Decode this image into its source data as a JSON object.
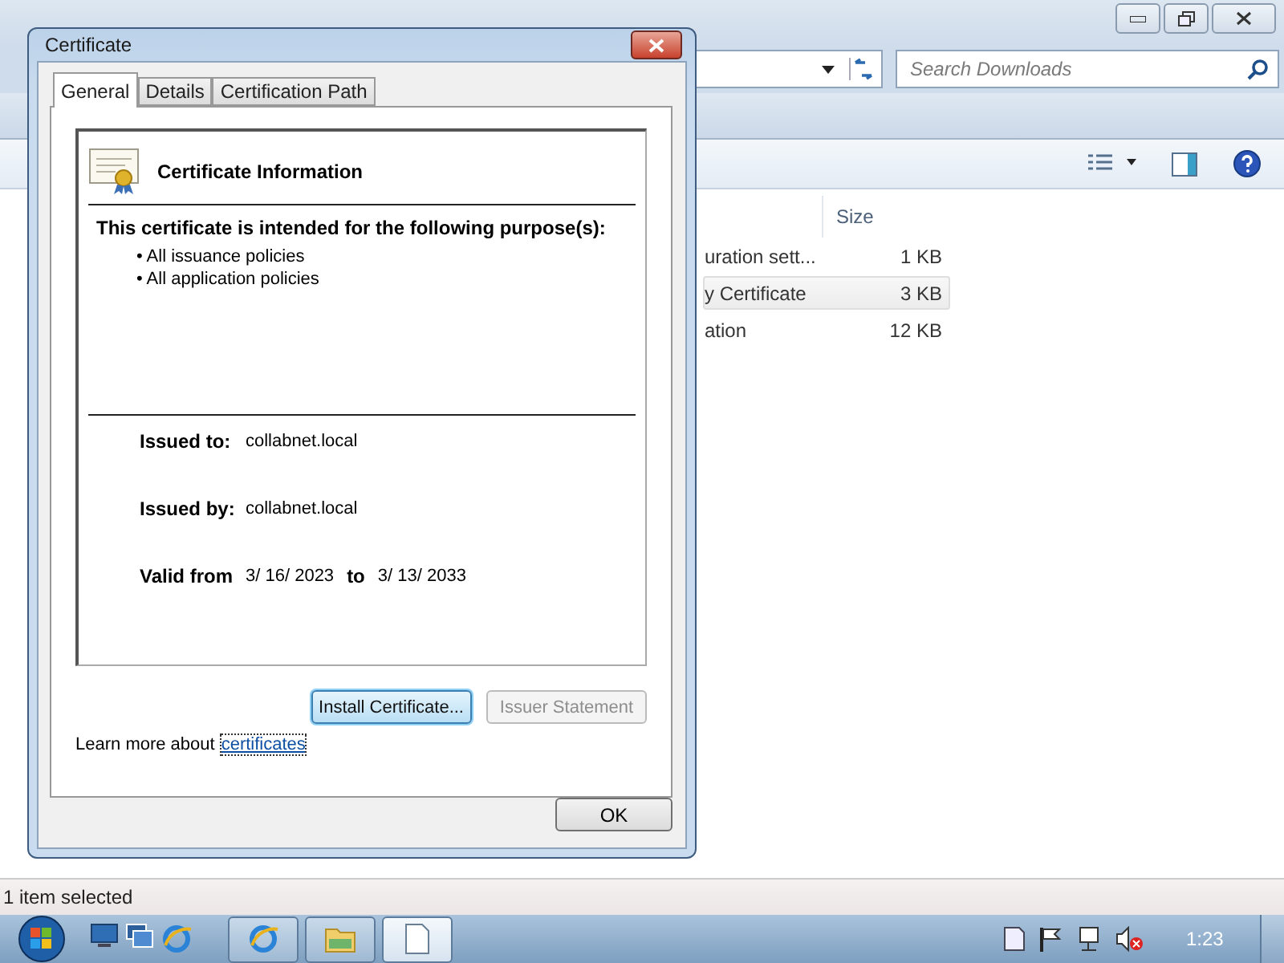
{
  "explorer": {
    "search": {
      "placeholder": "Search Downloads"
    },
    "columns": [
      "Size"
    ],
    "files": [
      {
        "name": "uration sett...",
        "size": "1 KB",
        "selected": false
      },
      {
        "name": "y Certificate",
        "size": "3 KB",
        "selected": true
      },
      {
        "name": "ation",
        "size": "12 KB",
        "selected": false
      }
    ],
    "status_bar": "1 item selected"
  },
  "dialog": {
    "title": "Certificate",
    "tabs": [
      {
        "label": "General",
        "selected": true
      },
      {
        "label": "Details",
        "selected": false
      },
      {
        "label": "Certification Path",
        "selected": false
      }
    ],
    "heading": "Certificate Information",
    "purpose_title": "This certificate is intended for the following purpose(s):",
    "purposes": [
      "• All issuance policies",
      "• All application policies"
    ],
    "fields": [
      {
        "label": "Issued to:",
        "value": "collabnet.local"
      },
      {
        "label": "Issued by:",
        "value": "collabnet.local"
      }
    ],
    "validity": {
      "label": "Valid from",
      "from": "3/ 16/ 2023",
      "joiner": "to",
      "to": "3/ 13/ 2033"
    },
    "buttons": [
      {
        "label": "Install Certificate...",
        "disabled": false,
        "focused": true
      },
      {
        "label": "Issuer Statement",
        "disabled": true,
        "focused": false
      }
    ],
    "learn_more": {
      "text": "Learn more about",
      "link": "certificates"
    },
    "ok": "OK"
  },
  "taskbar": {
    "quick_launch": [
      {
        "kind": "desktop"
      },
      {
        "kind": "windows"
      },
      {
        "kind": "browser"
      }
    ],
    "buttons": [
      {
        "kind": "browser",
        "selected": false
      },
      {
        "kind": "folder",
        "selected": false
      },
      {
        "kind": "document",
        "selected": true
      }
    ],
    "tray": [
      {
        "kind": "note"
      },
      {
        "kind": "flag"
      },
      {
        "kind": "network"
      },
      {
        "kind": "mute"
      }
    ],
    "clock": "1:23"
  }
}
